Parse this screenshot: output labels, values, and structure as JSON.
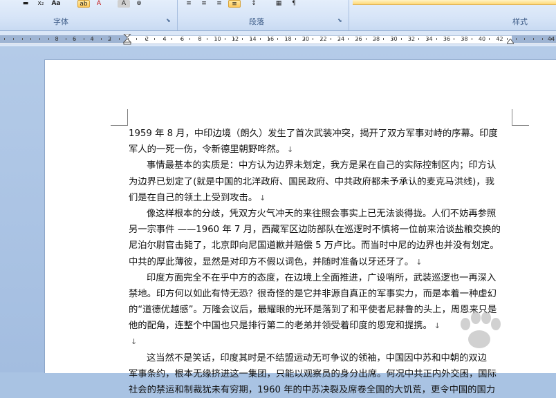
{
  "ribbon": {
    "groups": [
      {
        "label": "字体"
      },
      {
        "label": "段落"
      },
      {
        "label": "样式"
      }
    ],
    "font_buttons": [
      "▬",
      "x₂",
      "Aa",
      "ab",
      "A",
      "A",
      "⊕"
    ],
    "para_buttons": [
      "≡",
      "≡",
      "≡",
      "≡",
      "↕",
      "▦",
      "¶"
    ]
  },
  "ruler": {
    "left_ticks": [
      "8",
      "6",
      "4",
      "2"
    ],
    "right_ticks": [
      "2",
      "4",
      "6",
      "8",
      "10",
      "12",
      "14",
      "16",
      "18",
      "20",
      "22",
      "24",
      "26",
      "28",
      "30",
      "32",
      "34",
      "36",
      "38",
      "40",
      "42"
    ],
    "last_tick": "44"
  },
  "document": {
    "lines": [
      {
        "text": "1959 年 8 月，中印边境（朗久）发生了首次武装冲突，揭开了双方军事对峙的序幕。印度",
        "indent": false,
        "mark": false
      },
      {
        "text": "军人的一死一伤，令新德里朝野哗然。",
        "indent": false,
        "mark": true
      },
      {
        "text": "事情最基本的实质是：中方认为边界未划定，我方是呆在自己的实际控制区内；印方认",
        "indent": true,
        "mark": false
      },
      {
        "text": "为边界已划定了(就是中国的北洋政府、国民政府、中共政府都未予承认的麦克马洪线)，我",
        "indent": false,
        "mark": false
      },
      {
        "text": "们是在自己的领土上受到攻击。",
        "indent": false,
        "mark": true
      },
      {
        "text": "像这样根本的分歧，凭双方火气冲天的来往照会事实上已无法谈得拢。人们不妨再参照",
        "indent": true,
        "mark": false
      },
      {
        "text": "另一宗事件  ——1960 年 7 月，西藏军区边防部队在巡逻时不慎将一位前来洽谈盐粮交换的",
        "indent": false,
        "mark": false
      },
      {
        "text": "尼泊尔尉官击毙了，北京即向尼国道歉并赔偿 5 万卢比。而当时中尼的边界也并没有划定。",
        "indent": false,
        "mark": false
      },
      {
        "text": "中共的厚此薄彼，显然是对印方不假以词色，并随时准备以牙还牙了。",
        "indent": false,
        "mark": true
      },
      {
        "text": "印度方面完全不在乎中方的态度，在边境上全面推进，广设哨所，武装巡逻也一再深入",
        "indent": true,
        "mark": false
      },
      {
        "text": "禁地。印方何以如此有恃无恐？很奇怪的是它并非源自真正的军事实力，而是本着一种虚幻",
        "indent": false,
        "mark": false
      },
      {
        "text": "的“道德优越感”。万隆会议后，最耀眼的光环是落到了和平使者尼赫鲁的头上，周恩来只是",
        "indent": false,
        "mark": false
      },
      {
        "text": "他的配角，连整个中国也只是排行第二的老弟并领受着印度的恩宠和提携。",
        "indent": false,
        "mark": true
      },
      {
        "text": "",
        "indent": false,
        "mark": true
      },
      {
        "text": "这当然不是笑话，印度其时是不结盟运动无可争议的领袖，中国因中苏和中朝的双边",
        "indent": true,
        "mark": false
      },
      {
        "text": "军事条约，根本无缘挤进这一集团，只能以观察员的身分出席。何况中共正内外交困，国际",
        "indent": false,
        "mark": false
      },
      {
        "text": "社会的禁运和制裁犹未有穷期，1960 年的中苏决裂及席卷全国的大饥荒，更令中国的国力",
        "indent": false,
        "mark": false
      }
    ],
    "paragraph_mark": "↓"
  }
}
